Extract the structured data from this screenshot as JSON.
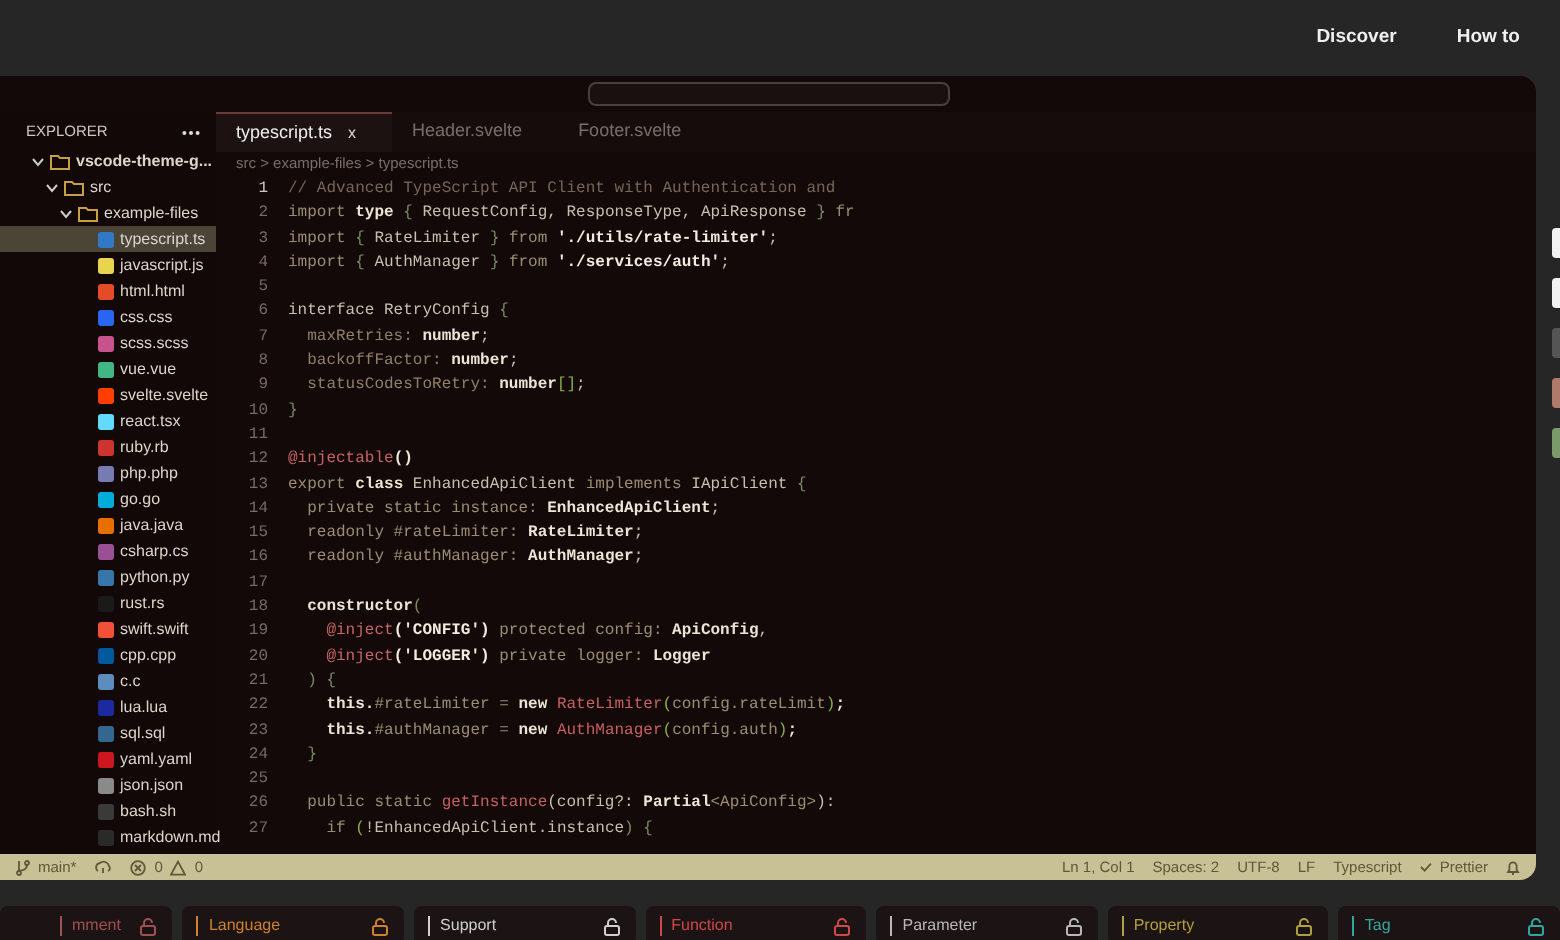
{
  "top_nav": {
    "links": [
      "Discover",
      "How to"
    ]
  },
  "explorer": {
    "title": "EXPLORER",
    "tree": [
      {
        "label": "vscode-theme-g...",
        "kind": "folder",
        "expanded": true,
        "selected": false,
        "children": [
          {
            "label": "src",
            "kind": "folder",
            "expanded": true,
            "selected": false,
            "children": [
              {
                "label": "example-files",
                "kind": "folder",
                "expanded": true,
                "selected": false,
                "children": [
                  {
                    "label": "typescript.ts",
                    "kind": "file",
                    "color": "#3178c6",
                    "selected": true
                  },
                  {
                    "label": "javascript.js",
                    "kind": "file",
                    "color": "#e8d44d",
                    "selected": false
                  },
                  {
                    "label": "html.html",
                    "kind": "file",
                    "color": "#e34c26",
                    "selected": false
                  },
                  {
                    "label": "css.css",
                    "kind": "file",
                    "color": "#2965f1",
                    "selected": false
                  },
                  {
                    "label": "scss.scss",
                    "kind": "file",
                    "color": "#c6538c",
                    "selected": false
                  },
                  {
                    "label": "vue.vue",
                    "kind": "file",
                    "color": "#41b883",
                    "selected": false
                  },
                  {
                    "label": "svelte.svelte",
                    "kind": "file",
                    "color": "#ff3e00",
                    "selected": false
                  },
                  {
                    "label": "react.tsx",
                    "kind": "file",
                    "color": "#61dafb",
                    "selected": false
                  },
                  {
                    "label": "ruby.rb",
                    "kind": "file",
                    "color": "#cc342d",
                    "selected": false
                  },
                  {
                    "label": "php.php",
                    "kind": "file",
                    "color": "#777bb3",
                    "selected": false
                  },
                  {
                    "label": "go.go",
                    "kind": "file",
                    "color": "#00add8",
                    "selected": false
                  },
                  {
                    "label": "java.java",
                    "kind": "file",
                    "color": "#e76f00",
                    "selected": false
                  },
                  {
                    "label": "csharp.cs",
                    "kind": "file",
                    "color": "#9b4f96",
                    "selected": false
                  },
                  {
                    "label": "python.py",
                    "kind": "file",
                    "color": "#3776ab",
                    "selected": false
                  },
                  {
                    "label": "rust.rs",
                    "kind": "file",
                    "color": "#1a1a1a",
                    "selected": false
                  },
                  {
                    "label": "swift.swift",
                    "kind": "file",
                    "color": "#f05138",
                    "selected": false
                  },
                  {
                    "label": "cpp.cpp",
                    "kind": "file",
                    "color": "#00599c",
                    "selected": false
                  },
                  {
                    "label": "c.c",
                    "kind": "file",
                    "color": "#5c8dbc",
                    "selected": false
                  },
                  {
                    "label": "lua.lua",
                    "kind": "file",
                    "color": "#1c2aa0",
                    "selected": false
                  },
                  {
                    "label": "sql.sql",
                    "kind": "file",
                    "color": "#336791",
                    "selected": false
                  },
                  {
                    "label": "yaml.yaml",
                    "kind": "file",
                    "color": "#cb171e",
                    "selected": false
                  },
                  {
                    "label": "json.json",
                    "kind": "file",
                    "color": "#8a8a8a",
                    "selected": false
                  },
                  {
                    "label": "bash.sh",
                    "kind": "file",
                    "color": "#3a3a3a",
                    "selected": false
                  },
                  {
                    "label": "markdown.md",
                    "kind": "file",
                    "color": "#2a2a2a",
                    "selected": false
                  }
                ]
              }
            ]
          }
        ]
      }
    ]
  },
  "tabs": [
    {
      "label": "typescript.ts",
      "selected": true,
      "close": "x"
    },
    {
      "label": "Header.svelte",
      "selected": false
    },
    {
      "label": "Footer.svelte",
      "selected": false
    }
  ],
  "breadcrumb": "src > example-files > typescript.ts",
  "code_lines": [
    {
      "number": "1",
      "active": true,
      "tokens": [
        {
          "text": "// Advanced TypeScript API Client with Authentication and",
          "kind": "comment"
        }
      ]
    },
    {
      "number": "2",
      "active": false,
      "tokens": [
        {
          "text": "import ",
          "kind": "keyword"
        },
        {
          "text": "type ",
          "kind": "bold"
        },
        {
          "text": "{ ",
          "kind": "punct"
        },
        {
          "text": "RequestConfig, ResponseType, ApiResponse ",
          "kind": "plain"
        },
        {
          "text": "} ",
          "kind": "punct"
        },
        {
          "text": "fr",
          "kind": "keyword"
        }
      ]
    },
    {
      "number": "3",
      "active": false,
      "tokens": [
        {
          "text": "import ",
          "kind": "keyword"
        },
        {
          "text": "{ ",
          "kind": "punct"
        },
        {
          "text": "RateLimiter ",
          "kind": "plain"
        },
        {
          "text": "} ",
          "kind": "punct"
        },
        {
          "text": "from ",
          "kind": "keyword"
        },
        {
          "text": "'./utils/rate-limiter'",
          "kind": "string"
        },
        {
          "text": ";",
          "kind": "plain"
        }
      ]
    },
    {
      "number": "4",
      "active": false,
      "tokens": [
        {
          "text": "import ",
          "kind": "keyword"
        },
        {
          "text": "{ ",
          "kind": "punct"
        },
        {
          "text": "AuthManager ",
          "kind": "plain"
        },
        {
          "text": "} ",
          "kind": "punct"
        },
        {
          "text": "from ",
          "kind": "keyword"
        },
        {
          "text": "'./services/auth'",
          "kind": "string"
        },
        {
          "text": ";",
          "kind": "plain"
        }
      ]
    },
    {
      "number": "5",
      "active": false
    },
    {
      "number": "6",
      "active": false,
      "tokens": [
        {
          "text": "interface RetryConfig ",
          "kind": "plain"
        },
        {
          "text": "{",
          "kind": "punct"
        }
      ]
    },
    {
      "number": "7",
      "active": false,
      "tokens": [
        {
          "text": "  maxRetries: ",
          "kind": "property"
        },
        {
          "text": "number",
          "kind": "bold"
        },
        {
          "text": ";",
          "kind": "plain"
        }
      ]
    },
    {
      "number": "8",
      "active": false,
      "tokens": [
        {
          "text": "  backoffFactor: ",
          "kind": "property"
        },
        {
          "text": "number",
          "kind": "bold"
        },
        {
          "text": ";",
          "kind": "plain"
        }
      ]
    },
    {
      "number": "9",
      "active": false,
      "tokens": [
        {
          "text": "  statusCodesToRetry: ",
          "kind": "property"
        },
        {
          "text": "number",
          "kind": "bold"
        },
        {
          "text": "[]",
          "kind": "bracket"
        },
        {
          "text": ";",
          "kind": "plain"
        }
      ]
    },
    {
      "number": "10",
      "active": false,
      "tokens": [
        {
          "text": "}",
          "kind": "punct"
        }
      ]
    },
    {
      "number": "11",
      "active": false
    },
    {
      "number": "12",
      "active": false,
      "tokens": [
        {
          "text": "@injectable",
          "kind": "decorator"
        },
        {
          "text": "()",
          "kind": "bold"
        }
      ]
    },
    {
      "number": "13",
      "active": false,
      "tokens": [
        {
          "text": "export ",
          "kind": "keyword"
        },
        {
          "text": "class ",
          "kind": "bold"
        },
        {
          "text": "EnhancedApiClient ",
          "kind": "plain"
        },
        {
          "text": "implements ",
          "kind": "keyword"
        },
        {
          "text": "IApiClient ",
          "kind": "plain"
        },
        {
          "text": "{",
          "kind": "punct"
        }
      ]
    },
    {
      "number": "14",
      "active": false,
      "tokens": [
        {
          "text": "  private static instance: ",
          "kind": "keyword"
        },
        {
          "text": "EnhancedApiClient",
          "kind": "bold"
        },
        {
          "text": ";",
          "kind": "plain"
        }
      ]
    },
    {
      "number": "15",
      "active": false,
      "tokens": [
        {
          "text": "  readonly #rateLimiter: ",
          "kind": "keyword"
        },
        {
          "text": "RateLimiter",
          "kind": "bold"
        },
        {
          "text": ";",
          "kind": "plain"
        }
      ]
    },
    {
      "number": "16",
      "active": false,
      "tokens": [
        {
          "text": "  readonly #authManager: ",
          "kind": "keyword"
        },
        {
          "text": "AuthManager",
          "kind": "bold"
        },
        {
          "text": ";",
          "kind": "plain"
        }
      ]
    },
    {
      "number": "17",
      "active": false
    },
    {
      "number": "18",
      "active": false,
      "tokens": [
        {
          "text": "  constructor",
          "kind": "bold"
        },
        {
          "text": "(",
          "kind": "punct"
        }
      ]
    },
    {
      "number": "19",
      "active": false,
      "tokens": [
        {
          "text": "    @inject",
          "kind": "decorator"
        },
        {
          "text": "('CONFIG') ",
          "kind": "string"
        },
        {
          "text": "protected config: ",
          "kind": "keyword"
        },
        {
          "text": "ApiConfig",
          "kind": "bold"
        },
        {
          "text": ",",
          "kind": "plain"
        }
      ]
    },
    {
      "number": "20",
      "active": false,
      "tokens": [
        {
          "text": "    @inject",
          "kind": "decorator"
        },
        {
          "text": "('LOGGER') ",
          "kind": "string"
        },
        {
          "text": "private logger: ",
          "kind": "keyword"
        },
        {
          "text": "Logger",
          "kind": "bold"
        }
      ]
    },
    {
      "number": "21",
      "active": false,
      "tokens": [
        {
          "text": "  ) {",
          "kind": "punct"
        }
      ]
    },
    {
      "number": "22",
      "active": false,
      "tokens": [
        {
          "text": "    this.",
          "kind": "bold"
        },
        {
          "text": "#rateLimiter = ",
          "kind": "keyword"
        },
        {
          "text": "new ",
          "kind": "bold"
        },
        {
          "text": "RateLimiter",
          "kind": "classname"
        },
        {
          "text": "(",
          "kind": "bracket"
        },
        {
          "text": "config.rateLimit",
          "kind": "keyword"
        },
        {
          "text": ")",
          "kind": "bracket"
        },
        {
          "text": ";",
          "kind": "bold"
        }
      ]
    },
    {
      "number": "23",
      "active": false,
      "tokens": [
        {
          "text": "    this.",
          "kind": "bold"
        },
        {
          "text": "#authManager = ",
          "kind": "keyword"
        },
        {
          "text": "new ",
          "kind": "bold"
        },
        {
          "text": "AuthManager",
          "kind": "classname"
        },
        {
          "text": "(",
          "kind": "bracket"
        },
        {
          "text": "config.auth",
          "kind": "keyword"
        },
        {
          "text": ")",
          "kind": "bracket"
        },
        {
          "text": ";",
          "kind": "bold"
        }
      ]
    },
    {
      "number": "24",
      "active": false,
      "tokens": [
        {
          "text": "  }",
          "kind": "punct"
        }
      ]
    },
    {
      "number": "25",
      "active": false
    },
    {
      "number": "26",
      "active": false,
      "tokens": [
        {
          "text": "  public static ",
          "kind": "keyword"
        },
        {
          "text": "getInstance",
          "kind": "classname"
        },
        {
          "text": "(config?: ",
          "kind": "plain"
        },
        {
          "text": "Partial",
          "kind": "bold"
        },
        {
          "text": "<ApiConfig>",
          "kind": "keyword"
        },
        {
          "text": "): ",
          "kind": "plain"
        }
      ]
    },
    {
      "number": "27",
      "active": false,
      "tokens": [
        {
          "text": "    if ",
          "kind": "keyword"
        },
        {
          "text": "(",
          "kind": "bracket"
        },
        {
          "text": "!EnhancedApiClient.instance",
          "kind": "plain"
        },
        {
          "text": ") {",
          "kind": "punct"
        }
      ]
    }
  ],
  "status_bar": {
    "branch": "main*",
    "errors": "0",
    "warnings": "0",
    "right_items": [
      {
        "text": "Ln 1, Col 1",
        "kind": "text"
      },
      {
        "text": "Spaces: 2",
        "kind": "text"
      },
      {
        "text": "UTF-8",
        "kind": "text"
      },
      {
        "text": "LF",
        "kind": "text"
      },
      {
        "text": "Typescript",
        "kind": "text"
      },
      {
        "text": "Prettier",
        "kind": "check"
      }
    ]
  },
  "token_cards": [
    {
      "label": "mment",
      "color": "#a05050"
    },
    {
      "label": "Language",
      "color": "#d08030"
    },
    {
      "label": "Support",
      "color": "#d0d0d0"
    },
    {
      "label": "Function",
      "color": "#d04848"
    },
    {
      "label": "Parameter",
      "color": "#b8b8b8"
    },
    {
      "label": "Property",
      "color": "#b0a040"
    },
    {
      "label": "Tag",
      "color": "#30a8a0"
    }
  ]
}
